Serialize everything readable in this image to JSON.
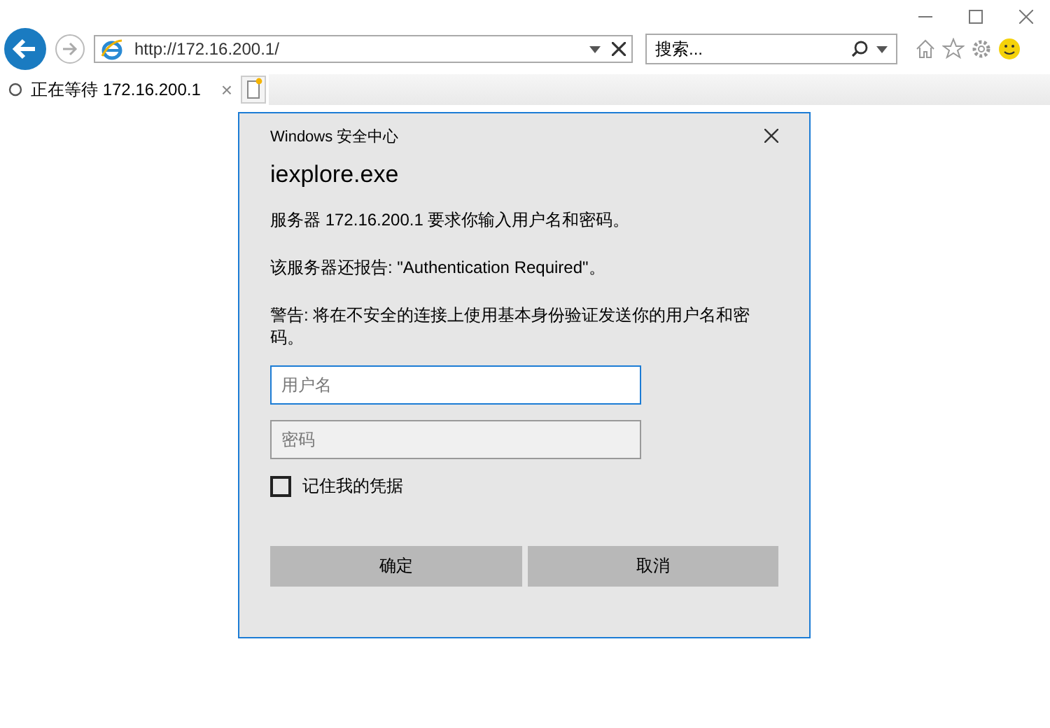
{
  "browser": {
    "address": "http://172.16.200.1/",
    "search": {
      "placeholder": "搜索..."
    },
    "tab": {
      "title": "正在等待 172.16.200.1",
      "loading": true,
      "close": "×"
    }
  },
  "dialog": {
    "caption": "Windows 安全中心",
    "app": "iexplore.exe",
    "messages": [
      "服务器 172.16.200.1 要求你输入用户名和密码。",
      "该服务器还报告: \"Authentication Required\"。",
      "警告: 将在不安全的连接上使用基本身份验证发送你的用户名和密码。"
    ],
    "fields": [
      {
        "placeholder": "用户名",
        "focused": true
      },
      {
        "placeholder": "密码",
        "focused": false
      }
    ],
    "remember": {
      "label": "记住我的凭据",
      "checked": false
    },
    "buttons": [
      "确定",
      "取消"
    ]
  }
}
